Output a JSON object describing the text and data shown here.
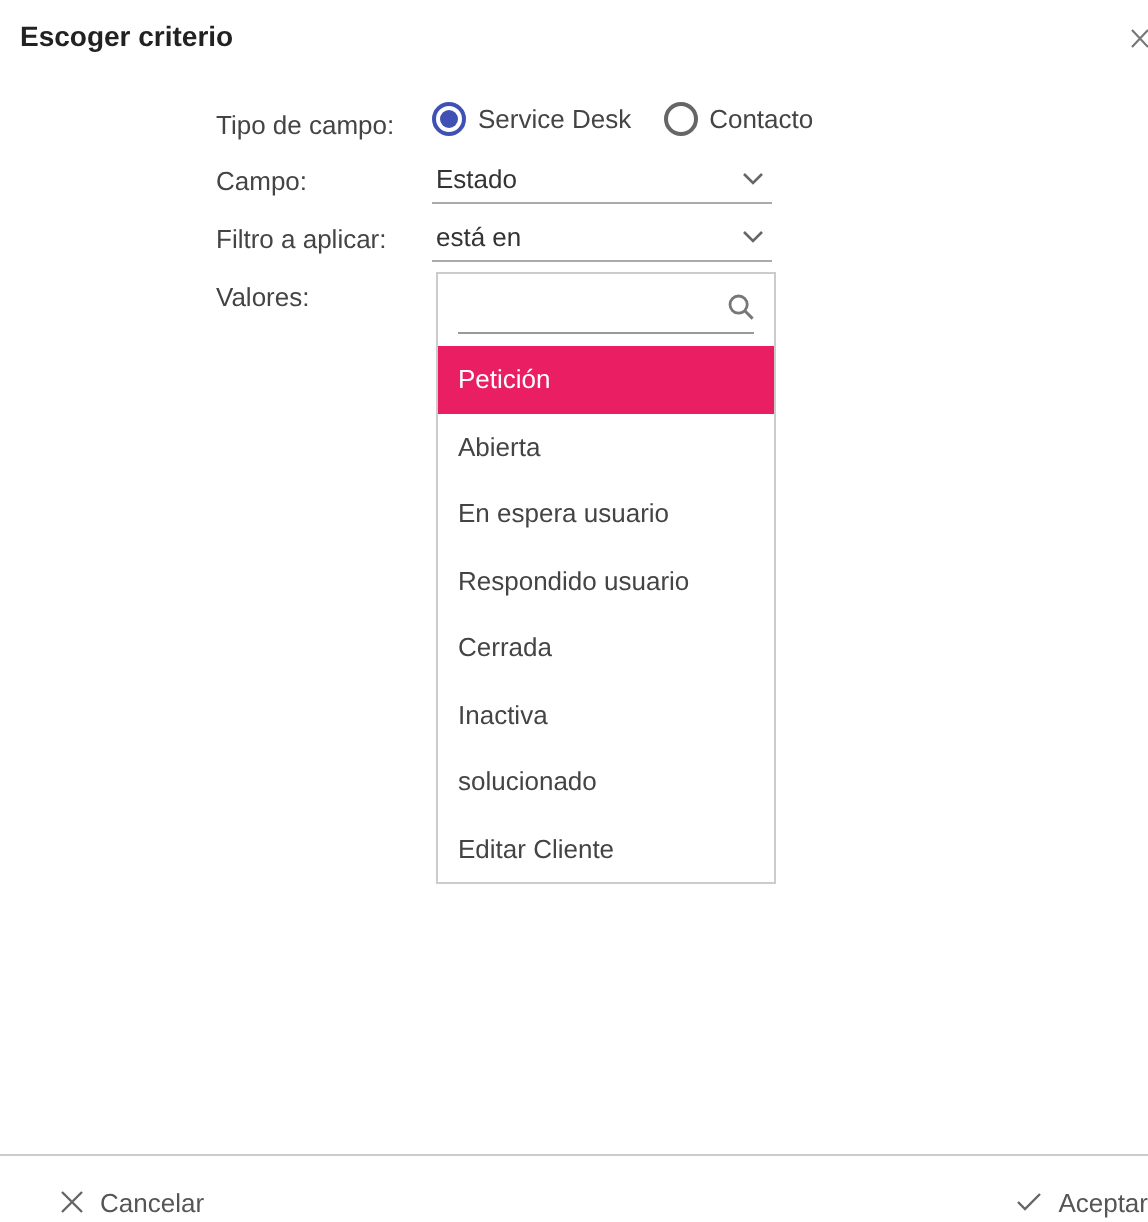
{
  "dialog": {
    "title": "Escoger criterio"
  },
  "fields": [
    {
      "kind": "radio",
      "label": "Tipo de campo:",
      "options": [
        {
          "label": "Service Desk",
          "selected": true
        },
        {
          "label": "Contacto",
          "selected": false
        }
      ]
    },
    {
      "kind": "select",
      "label": "Campo:",
      "value": "Estado"
    },
    {
      "kind": "select",
      "label": "Filtro a aplicar:",
      "value": "está en"
    },
    {
      "kind": "list",
      "label": "Valores:",
      "items": [
        {
          "label": "Petición",
          "selected": true
        },
        {
          "label": "Abierta",
          "selected": false
        },
        {
          "label": "En espera usuario",
          "selected": false
        },
        {
          "label": "Respondido usuario",
          "selected": false
        },
        {
          "label": "Cerrada",
          "selected": false
        },
        {
          "label": "Inactiva",
          "selected": false
        },
        {
          "label": "solucionado",
          "selected": false
        },
        {
          "label": "Editar Cliente",
          "selected": false
        }
      ]
    }
  ],
  "buttons": [
    {
      "kind": "cancel",
      "label": "Cancelar"
    },
    {
      "kind": "accept",
      "label": "Aceptar"
    }
  ]
}
